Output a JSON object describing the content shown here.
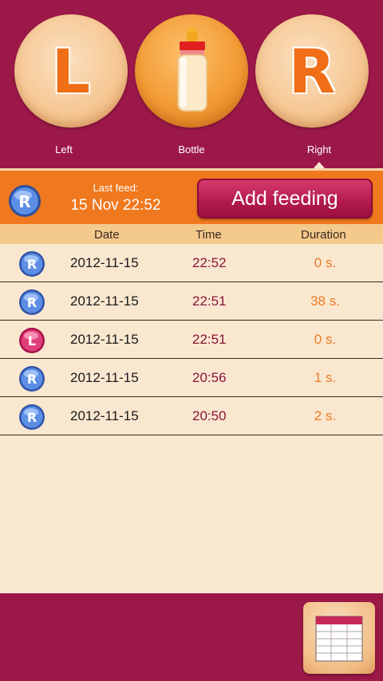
{
  "choices": {
    "left": {
      "letter": "L",
      "label": "Left"
    },
    "bottle": {
      "label": "Bottle"
    },
    "right": {
      "letter": "R",
      "label": "Right"
    },
    "selected": "Right"
  },
  "status_bar": {
    "badge": "R",
    "last_feed_label": "Last feed:",
    "last_feed_value": "15 Nov 22:52",
    "add_button": "Add feeding"
  },
  "table": {
    "headers": {
      "date": "Date",
      "time": "Time",
      "duration": "Duration"
    },
    "rows": [
      {
        "side": "R",
        "date": "2012-11-15",
        "time": "22:52",
        "duration": "0 s."
      },
      {
        "side": "R",
        "date": "2012-11-15",
        "time": "22:51",
        "duration": "38 s."
      },
      {
        "side": "L",
        "date": "2012-11-15",
        "time": "22:51",
        "duration": "0 s."
      },
      {
        "side": "R",
        "date": "2012-11-15",
        "time": "20:56",
        "duration": "1 s."
      },
      {
        "side": "R",
        "date": "2012-11-15",
        "time": "20:50",
        "duration": "2 s."
      }
    ]
  },
  "bottom": {
    "table_button_icon": "table-icon"
  },
  "colors": {
    "primary": "#9c1848",
    "accent": "#f0781e",
    "background": "#f9e7d0",
    "header": "#f3c98c",
    "right_badge": "#5a8ee0",
    "left_badge": "#e0407a"
  }
}
